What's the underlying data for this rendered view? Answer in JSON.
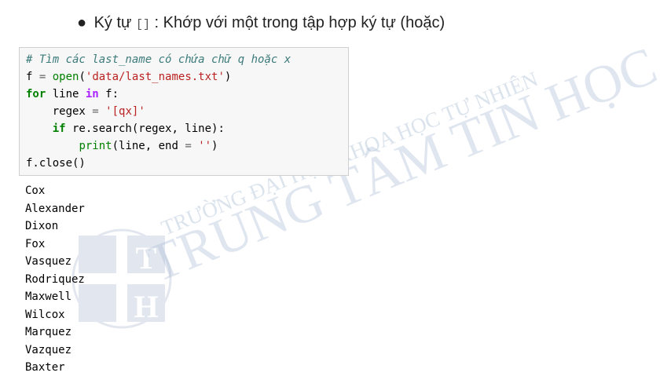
{
  "bullet": {
    "prefix": "Ký tự",
    "code": "[]",
    "suffix": ": Khớp với một trong tập hợp ký tự (hoặc)"
  },
  "code_cell": {
    "comment": "# Tìm các last_name có chứa chữ q hoặc x",
    "l2_var": "f",
    "l2_eq": " = ",
    "l2_func": "open",
    "l2_paren_open": "(",
    "l2_str": "'data/last_names.txt'",
    "l2_paren_close": ")",
    "l3_for": "for",
    "l3_mid": " line ",
    "l3_in": "in",
    "l3_end": " f:",
    "l4_indent": "    regex ",
    "l4_eq": "=",
    "l4_sp": " ",
    "l4_str": "'[qx]'",
    "l5_indent": "    ",
    "l5_if": "if",
    "l5_rest": " re.search(regex, line):",
    "l6_indent": "        ",
    "l6_print": "print",
    "l6_mid": "(line, end ",
    "l6_eq": "=",
    "l6_sp": " ",
    "l6_str": "''",
    "l6_close": ")",
    "l7": "f.close()"
  },
  "output": [
    "Cox",
    "Alexander",
    "Dixon",
    "Fox",
    "Vasquez",
    "Rodriquez",
    "Maxwell",
    "Wilcox",
    "Marquez",
    "Vazquez",
    "Baxter"
  ],
  "watermark": {
    "line1": "TRƯỜNG ĐẠI HỌC KHOA HỌC TỰ NHIÊN",
    "line2": "TRUNG TÂM TIN HỌC",
    "logo_top": "T",
    "logo_bottom": "H",
    "color": "#9ab0cc"
  }
}
